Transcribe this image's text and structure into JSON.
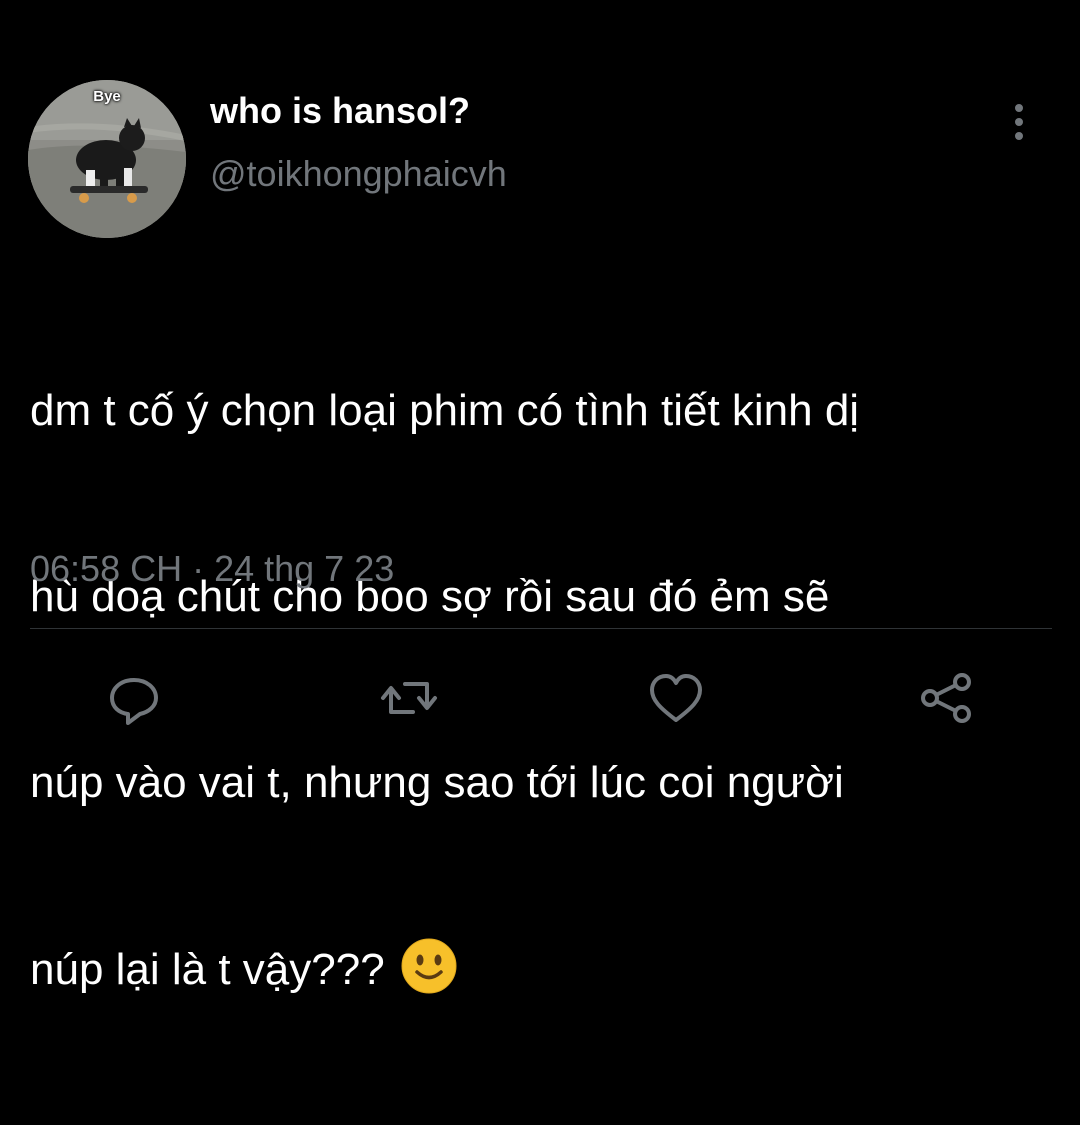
{
  "tweet": {
    "avatar": {
      "caption": "Bye",
      "icon": "cat-on-skateboard-photo"
    },
    "display_name": "who is hansol?",
    "handle": "@toikhongphaicvh",
    "more_icon": "vertical-ellipsis-icon",
    "text_lines": [
      "dm t cố ý chọn loại phim có tình tiết kinh dị",
      "hù doạ chút cho boo sợ rồi sau đó ẻm sẽ",
      "núp vào vai t, nhưng sao tới lúc coi người",
      "núp lại là t vậy???"
    ],
    "emoji": "slightly-smiling-face",
    "timestamp": "06:58 CH · 24 thg 7 23"
  },
  "actions": [
    {
      "name": "reply",
      "icon": "reply-icon"
    },
    {
      "name": "retweet",
      "icon": "retweet-icon"
    },
    {
      "name": "like",
      "icon": "heart-icon"
    },
    {
      "name": "share",
      "icon": "share-icon"
    }
  ],
  "colors": {
    "background": "#000000",
    "primary_text": "#ffffff",
    "secondary_text": "#71767b",
    "divider": "#2f3336",
    "emoji_yellow": "#f7c02a"
  }
}
